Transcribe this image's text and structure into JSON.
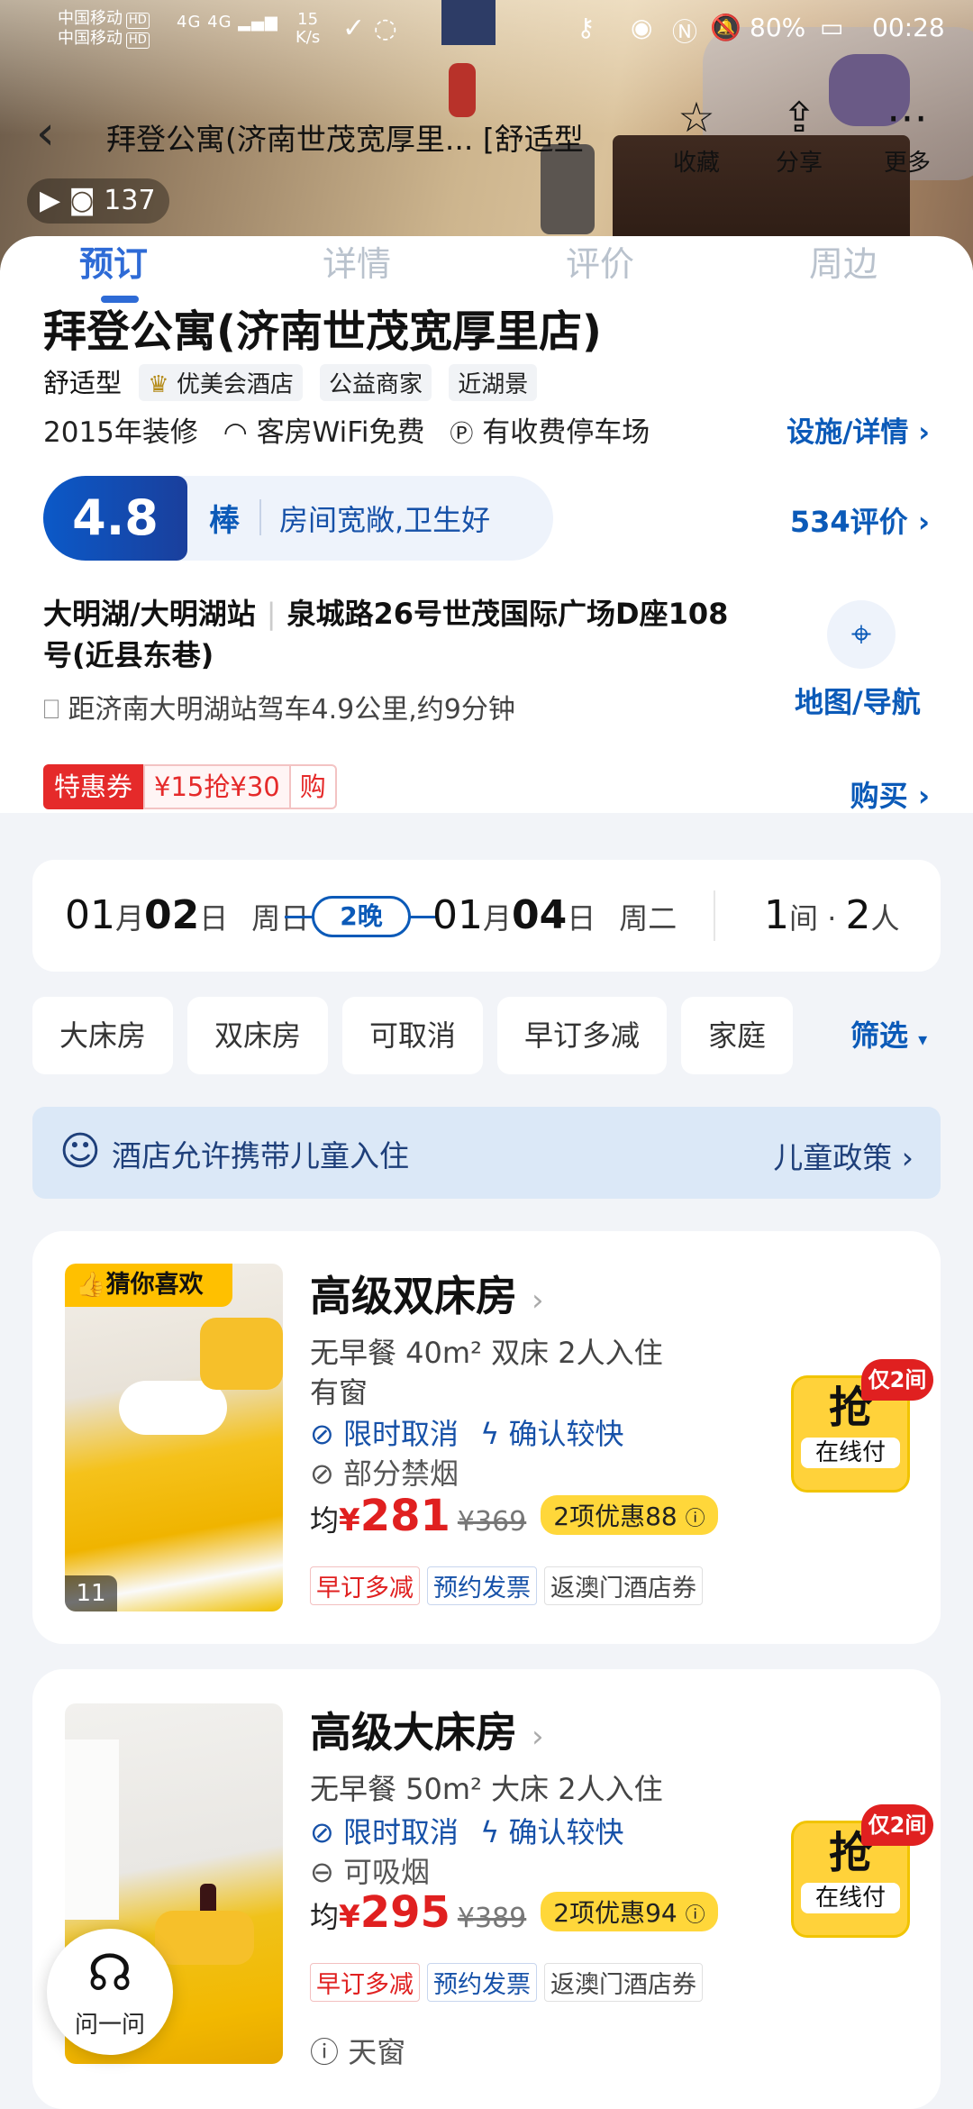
{
  "status_bar": {
    "carrier1": "中国移动",
    "carrier2": "中国移动",
    "hd": "HD",
    "signal": "4G 4G",
    "speed_value": "15",
    "speed_unit": "K/s",
    "battery": "80%",
    "time": "00:28"
  },
  "nav": {
    "title": "拜登公寓(济南世茂宽厚里...  [舒适型",
    "favorite_label": "收藏",
    "share_label": "分享",
    "more_label": "更多"
  },
  "photo_count": "137",
  "tabs": [
    "预订",
    "详情",
    "评价",
    "周边"
  ],
  "hotel": {
    "name": "拜登公寓(济南世茂宽厚里店)",
    "type": "舒适型",
    "chips": [
      "优美会酒店",
      "公益商家",
      "近湖景"
    ],
    "renovated": "2015年装修",
    "wifi": "客房WiFi免费",
    "parking": "有收费停车场",
    "facilities_link": "设施/详情",
    "score": "4.8",
    "score_word": "棒",
    "score_comment": "房间宽敞,卫生好",
    "reviews_link": "534评价",
    "area": "大明湖/大明湖站",
    "address": "泉城路26号世茂国际广场D座108号(近县东巷)",
    "distance": "距济南大明湖站驾车4.9公里,约9分钟",
    "map_label": "地图/导航",
    "coupon_tag": "特惠券",
    "coupon_value": "¥15抢¥30",
    "coupon_buy": "购",
    "buy_link": "购买"
  },
  "dates": {
    "checkin_month": "01",
    "checkin_day": "02",
    "checkin_weekday": "周日",
    "nights": "2晚",
    "checkout_month": "01",
    "checkout_day": "04",
    "checkout_weekday": "周二",
    "rooms": "1",
    "room_unit": "间",
    "guests": "2",
    "guest_unit": "人",
    "month_char": "月",
    "day_char": "日"
  },
  "filters": [
    "大床房",
    "双床房",
    "可取消",
    "早订多减",
    "家庭"
  ],
  "filter_button": "筛选",
  "kids": {
    "text": "酒店允许携带儿童入住",
    "link": "儿童政策"
  },
  "rooms": [
    {
      "badge": "猜你喜欢",
      "photo_count": "11",
      "name": "高级双床房",
      "desc": "无早餐 40m² 双床 2人入住",
      "desc2": "有窗",
      "cancel": "限时取消",
      "confirm": "确认较快",
      "smoke": "部分禁烟",
      "price_prefix": "均",
      "currency": "¥",
      "price": "281",
      "old_price": "¥369",
      "discount": "2项优惠88",
      "tags": [
        "早订多减",
        "预约发票",
        "返澳门酒店券"
      ],
      "grab": "抢",
      "pay": "在线付",
      "only": "仅2间"
    },
    {
      "name": "高级大床房",
      "desc": "无早餐 50m² 大床 2人入住",
      "cancel": "限时取消",
      "confirm": "确认较快",
      "smoke": "可吸烟",
      "price_prefix": "均",
      "currency": "¥",
      "price": "295",
      "old_price": "¥389",
      "discount": "2项优惠94",
      "tags": [
        "早订多减",
        "预约发票",
        "返澳门酒店券"
      ],
      "window": "天窗",
      "grab": "抢",
      "pay": "在线付",
      "only": "仅2间"
    }
  ],
  "ask_label": "问一问"
}
